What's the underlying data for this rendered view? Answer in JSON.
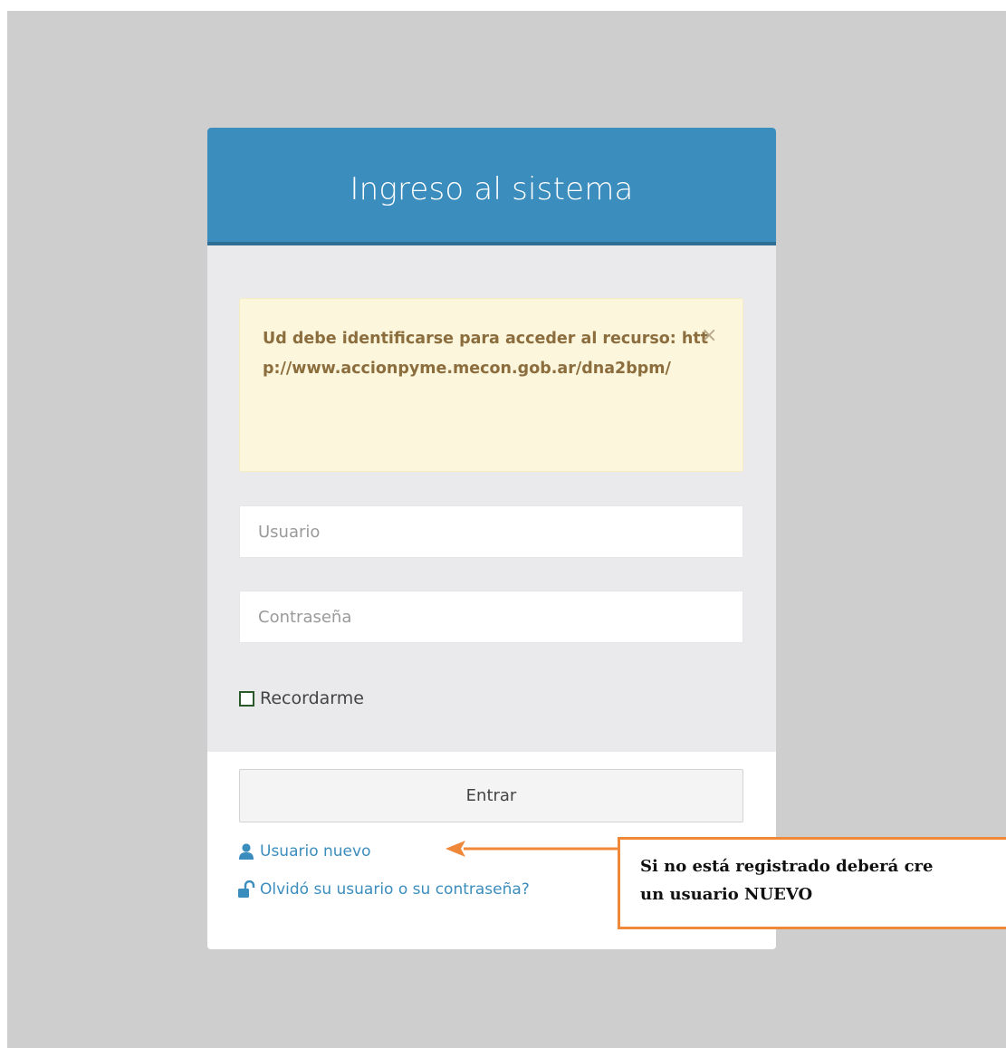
{
  "login": {
    "title": "Ingreso al sistema",
    "alert": {
      "message": "Ud debe identificarse para acceder al recurso: http://www.accionpyme.mecon.gob.ar/dna2bpm/",
      "close_glyph": "×"
    },
    "username": {
      "placeholder": "Usuario",
      "value": ""
    },
    "password": {
      "placeholder": "Contraseña",
      "value": ""
    },
    "remember_label": "Recordarme",
    "remember_checked": false,
    "submit_label": "Entrar",
    "links": {
      "new_user": {
        "label": "Usuario nuevo",
        "icon": "user-icon"
      },
      "forgot": {
        "label": "Olvidó su usuario o su contraseña?",
        "icon": "unlock-icon"
      }
    }
  },
  "annotation": {
    "line1": "Si no está registrado deberá cre",
    "line2": "un usuario NUEVO"
  },
  "colors": {
    "header": "#3b8dbd",
    "link": "#3b8dbd",
    "alert_bg": "#fcf6dc",
    "alert_text": "#8b6d3e",
    "annotation_border": "#f0883a",
    "page_bg": "#cecece"
  }
}
